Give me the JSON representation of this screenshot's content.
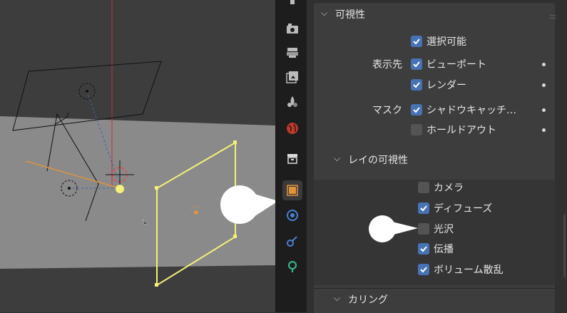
{
  "visibility": {
    "title": "可視性",
    "selectable": {
      "label": "選択可能",
      "checked": true
    },
    "show_in_label": "表示先",
    "viewport": {
      "label": "ビューポート",
      "checked": true
    },
    "render": {
      "label": "レンダー",
      "checked": true
    },
    "mask_label": "マスク",
    "shadow_catcher": {
      "label": "シャドウキャッチ…",
      "checked": true
    },
    "holdout": {
      "label": "ホールドアウト",
      "checked": false
    }
  },
  "ray_visibility": {
    "title": "レイの可視性",
    "items": [
      {
        "label": "カメラ",
        "checked": false
      },
      {
        "label": "ディフューズ",
        "checked": true
      },
      {
        "label": "光沢",
        "checked": false
      },
      {
        "label": "伝播",
        "checked": true
      },
      {
        "label": "ボリューム散乱",
        "checked": true
      }
    ]
  },
  "culling": {
    "title": "カリング"
  },
  "tabs": [
    "tool-icon",
    "render-icon",
    "output-icon",
    "view-layer-icon",
    "scene-icon",
    "world-icon",
    "collection-icon",
    "object-icon",
    "modifier-icon",
    "physics-icon",
    "constraints-icon"
  ],
  "colors": {
    "accent": "#4772b3",
    "active_object": "#f4f07a",
    "light": "#e0933f"
  }
}
